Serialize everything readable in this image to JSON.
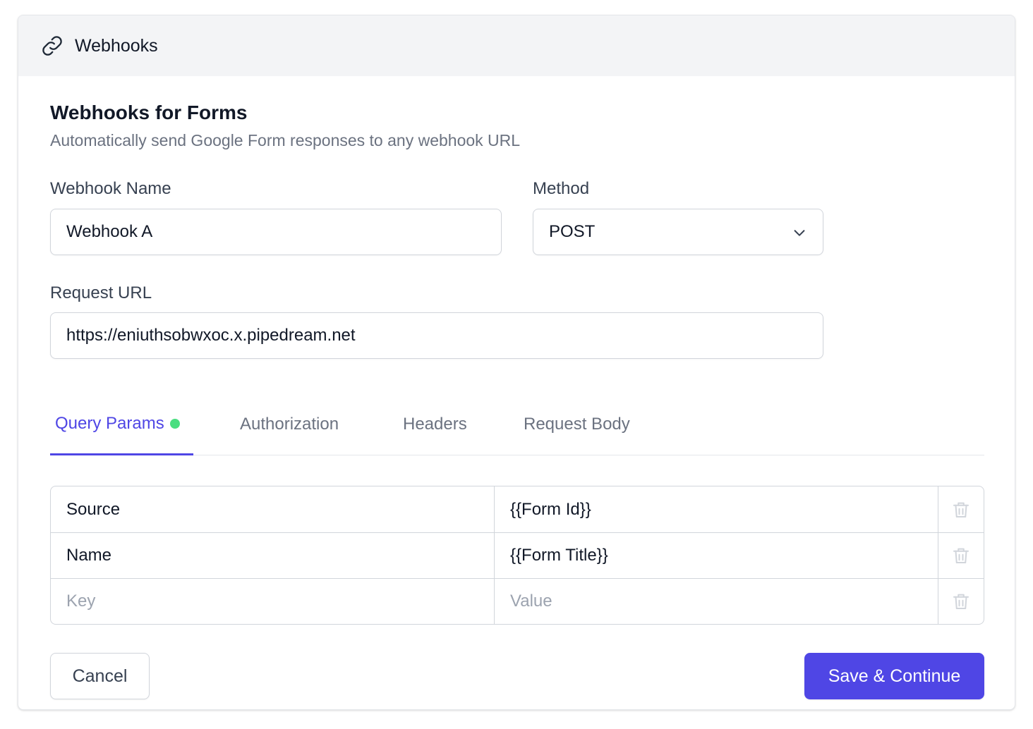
{
  "header": {
    "title": "Webhooks",
    "icon": "link-icon"
  },
  "section": {
    "title": "Webhooks for Forms",
    "subtitle": "Automatically send Google Form responses to any webhook URL"
  },
  "form": {
    "webhook_name": {
      "label": "Webhook Name",
      "value": "Webhook A"
    },
    "method": {
      "label": "Method",
      "value": "POST"
    },
    "request_url": {
      "label": "Request URL",
      "value": "https://eniuthsobwxoc.x.pipedream.net"
    }
  },
  "tabs": [
    {
      "label": "Query Params",
      "active": true,
      "indicator_color": "#4ade80"
    },
    {
      "label": "Authorization",
      "active": false
    },
    {
      "label": "Headers",
      "active": false
    },
    {
      "label": "Request Body",
      "active": false
    }
  ],
  "query_params": {
    "rows": [
      {
        "key": "Source",
        "value": "{{Form Id}}"
      },
      {
        "key": "Name",
        "value": "{{Form Title}}"
      }
    ],
    "empty_row": {
      "key_placeholder": "Key",
      "value_placeholder": "Value"
    }
  },
  "buttons": {
    "cancel": "Cancel",
    "save": "Save & Continue"
  },
  "colors": {
    "accent": "#4f46e5",
    "active_dot": "#4ade80",
    "header_bg": "#f3f4f6"
  }
}
